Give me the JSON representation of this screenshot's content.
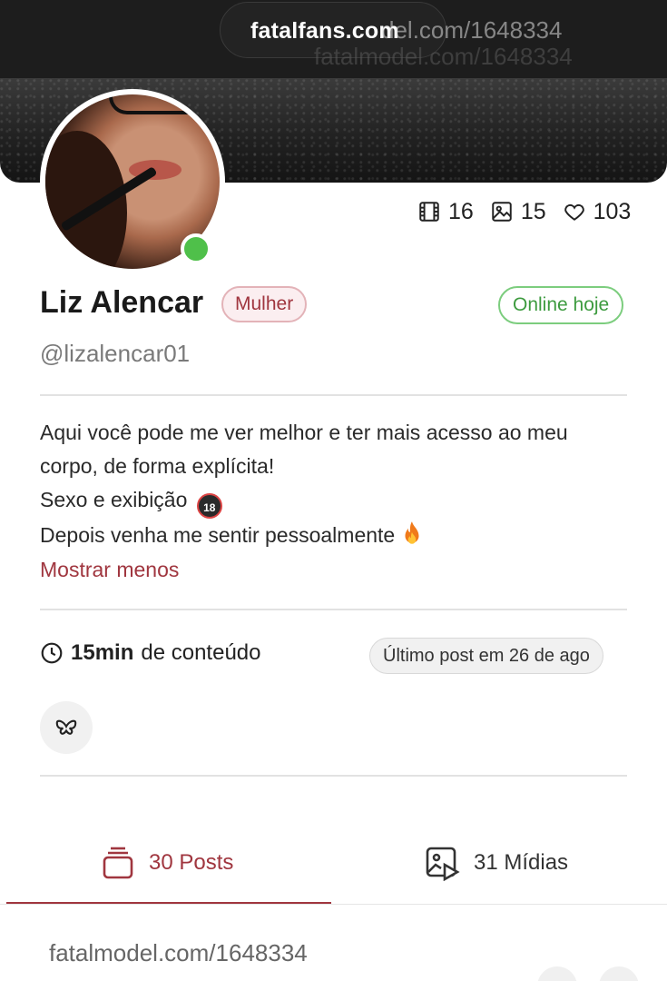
{
  "browser": {
    "url": "fatalfans.com",
    "watermark": "fatalmodel.com/1648334",
    "watermark_partial": "del.com/1648334"
  },
  "profile": {
    "name": "Liz Alencar",
    "gender": "Mulher",
    "status": "Online hoje",
    "handle": "@lizalencar01",
    "online": true
  },
  "stats": {
    "videos": "16",
    "photos": "15",
    "likes": "103"
  },
  "bio": {
    "lines": [
      "Aqui você pode me ver melhor e ter mais acesso ao meu",
      "corpo, de forma explícita!",
      "Sexo e exibição",
      "Depois venha me sentir pessoalmente"
    ],
    "emoji_18": "18",
    "toggle_label": "Mostrar menos"
  },
  "content": {
    "duration": "15min",
    "suffix": "de conteúdo",
    "last_post": "Último post em 26 de ago"
  },
  "social": {
    "icon": "butterfly-icon"
  },
  "tabs": [
    {
      "label": "30 Posts",
      "icon": "stack-icon",
      "active": true
    },
    {
      "label": "31 Mídias",
      "icon": "media-play-icon",
      "active": false
    }
  ],
  "footer": {
    "watermark": "fatalmodel.com/1648334"
  },
  "colors": {
    "accent": "#a0363f",
    "online": "#4fc04a",
    "online_text": "#3d9b3f"
  }
}
